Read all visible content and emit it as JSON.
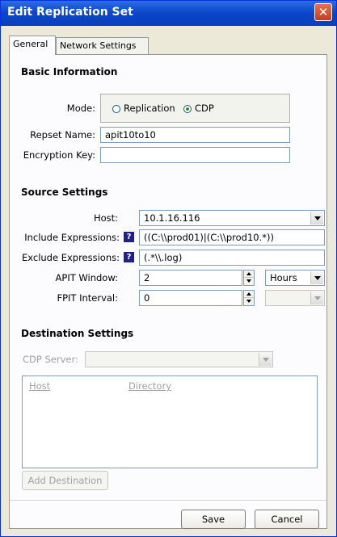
{
  "window": {
    "title": "Edit Replication Set",
    "close_glyph": "✕"
  },
  "tabs": [
    {
      "label": "General",
      "active": true
    },
    {
      "label": "Network Settings",
      "active": false
    }
  ],
  "basic": {
    "section_title": "Basic Information",
    "mode_label": "Mode:",
    "mode_options": [
      {
        "label": "Replication",
        "checked": false
      },
      {
        "label": "CDP",
        "checked": true
      }
    ],
    "repset_name_label": "Repset Name:",
    "repset_name_value": "apit10to10",
    "encryption_key_label": "Encryption Key:",
    "encryption_key_value": ""
  },
  "source": {
    "section_title": "Source Settings",
    "host_label": "Host:",
    "host_value": "10.1.16.116",
    "include_label": "Include Expressions:",
    "include_value": "((C:\\\\prod01)|(C:\\\\prod10.*))",
    "exclude_label": "Exclude Expressions:",
    "exclude_value": "(.*\\\\.log)",
    "help_glyph": "?",
    "apit_label": "APIT Window:",
    "apit_value": "2",
    "apit_unit": "Hours",
    "fpit_label": "FPIT Interval:",
    "fpit_value": "0",
    "fpit_unit": ""
  },
  "destination": {
    "section_title": "Destination Settings",
    "cdp_server_label": "CDP Server:",
    "cdp_server_value": "",
    "columns": [
      "Host",
      "Directory"
    ],
    "add_button": "Add Destination"
  },
  "footer": {
    "save_label": "Save",
    "cancel_label": "Cancel"
  },
  "colors": {
    "titlebar": "#0a46c8",
    "panel_bg": "#fcfcfe",
    "window_bg": "#ece9d8",
    "help_icon_bg": "#20208a"
  }
}
